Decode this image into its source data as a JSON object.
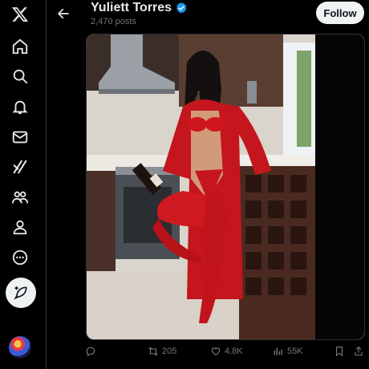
{
  "profile": {
    "name": "Yuliett Torres",
    "posts": "2,470 posts",
    "follow_label": "Follow"
  },
  "nav": [
    {
      "name": "x-logo-icon"
    },
    {
      "name": "home-icon"
    },
    {
      "name": "search-icon"
    },
    {
      "name": "notifications-icon"
    },
    {
      "name": "messages-icon"
    },
    {
      "name": "grok-icon"
    },
    {
      "name": "communities-icon"
    },
    {
      "name": "profile-icon"
    },
    {
      "name": "more-icon"
    }
  ],
  "actions": {
    "reply": "",
    "retweets": "205",
    "likes": "4.8K",
    "views": "55K"
  },
  "colors": {
    "background": "#000000",
    "text": "#e7e9ea",
    "muted": "#71767b",
    "verified": "#1d9bf0",
    "border": "#2f3336"
  }
}
